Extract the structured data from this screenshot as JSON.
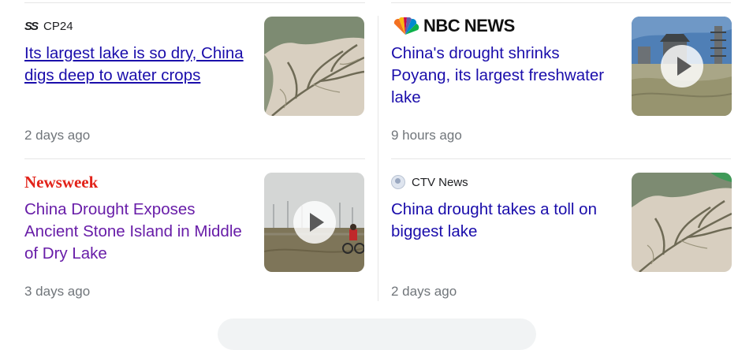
{
  "cards": [
    {
      "source": "CP24",
      "title": "Its largest lake is so dry, China digs deep to water crops",
      "time": "2 days ago",
      "thumb_icon": "lake-bed-image"
    },
    {
      "source": "NBC NEWS",
      "title": "China's drought shrinks Poyang, its largest freshwater lake",
      "time": "9 hours ago",
      "thumb_icon": "pagoda-video-image"
    },
    {
      "source": "Newsweek",
      "title": "China Drought Exposes Ancient Stone Island in Middle of Dry Lake",
      "time": "3 days ago",
      "thumb_icon": "cyclist-video-image"
    },
    {
      "source": "CTV News",
      "title": "China drought takes a toll on biggest lake",
      "time": "2 days ago",
      "thumb_icon": "lake-bed-image"
    }
  ],
  "colors": {
    "link": "#1a0dab",
    "visited": "#681da8",
    "meta": "#70757a",
    "newsweek_red": "#e2231a"
  }
}
